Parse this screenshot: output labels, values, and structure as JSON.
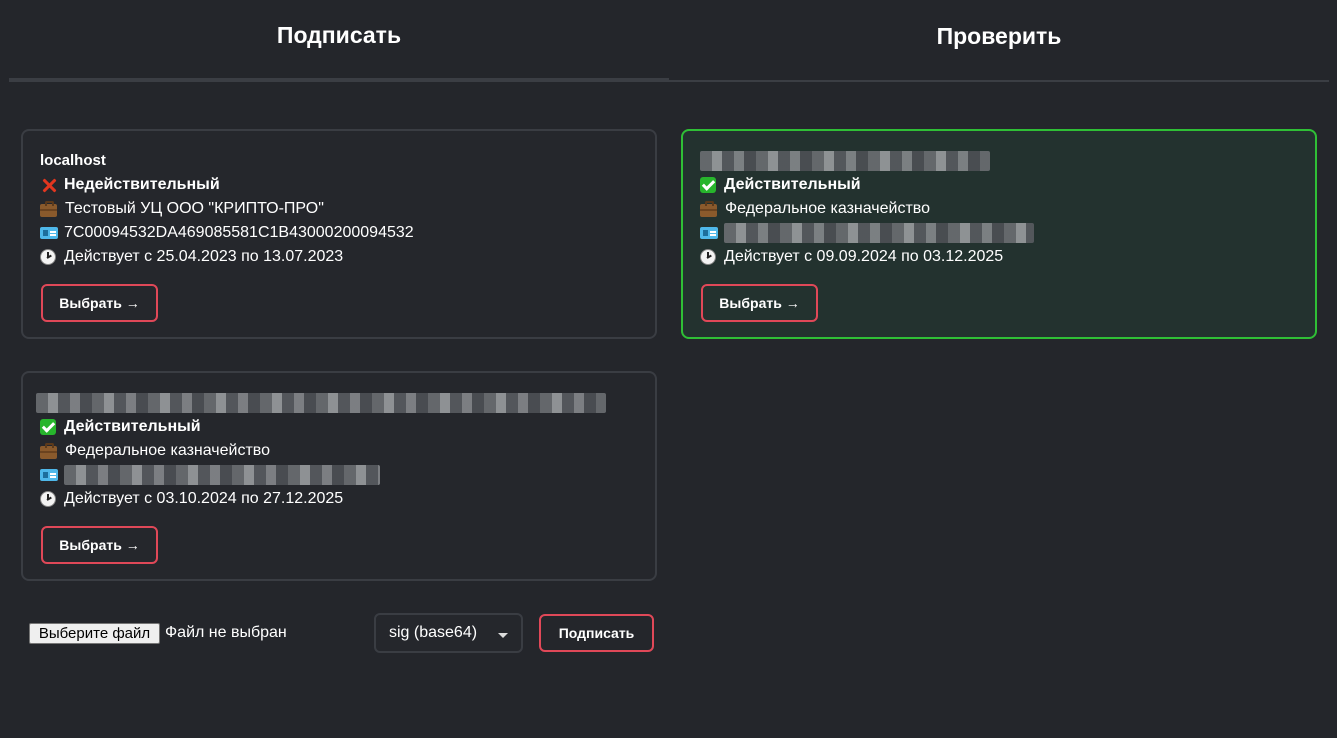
{
  "tabs": {
    "sign": "Подписать",
    "verify": "Проверить"
  },
  "certificates": [
    {
      "title": "localhost",
      "status": "Недействительный",
      "issuer": "Тестовый УЦ ООО \"КРИПТО-ПРО\"",
      "serial": "7C00094532DA469085581C1B43000200094532",
      "validity": "Действует с 25.04.2023 по 13.07.2023",
      "select_label": "Выбрать →"
    },
    {
      "status": "Действительный",
      "issuer": "Федеральное казначейство",
      "validity": "Действует с 09.09.2024 по 03.12.2025",
      "select_label": "Выбрать →"
    },
    {
      "status": "Действительный",
      "issuer": "Федеральное казначейство",
      "validity": "Действует с 03.10.2024 по 27.12.2025",
      "select_label": "Выбрать →"
    }
  ],
  "icons": {
    "invalid": "cross-mark-icon",
    "valid": "check-mark-icon",
    "issuer": "briefcase-icon",
    "serial": "id-card-icon",
    "validity": "clock-icon"
  },
  "colors": {
    "background": "#24262b",
    "accent_border": "#e04858",
    "valid_border": "#2fbf36",
    "invalid_mark": "#e2361f"
  },
  "footer": {
    "file_button": "Выберите файл",
    "file_status": "Файл не выбран",
    "format_selected": "sig (base64)",
    "sign_button": "Подписать"
  }
}
